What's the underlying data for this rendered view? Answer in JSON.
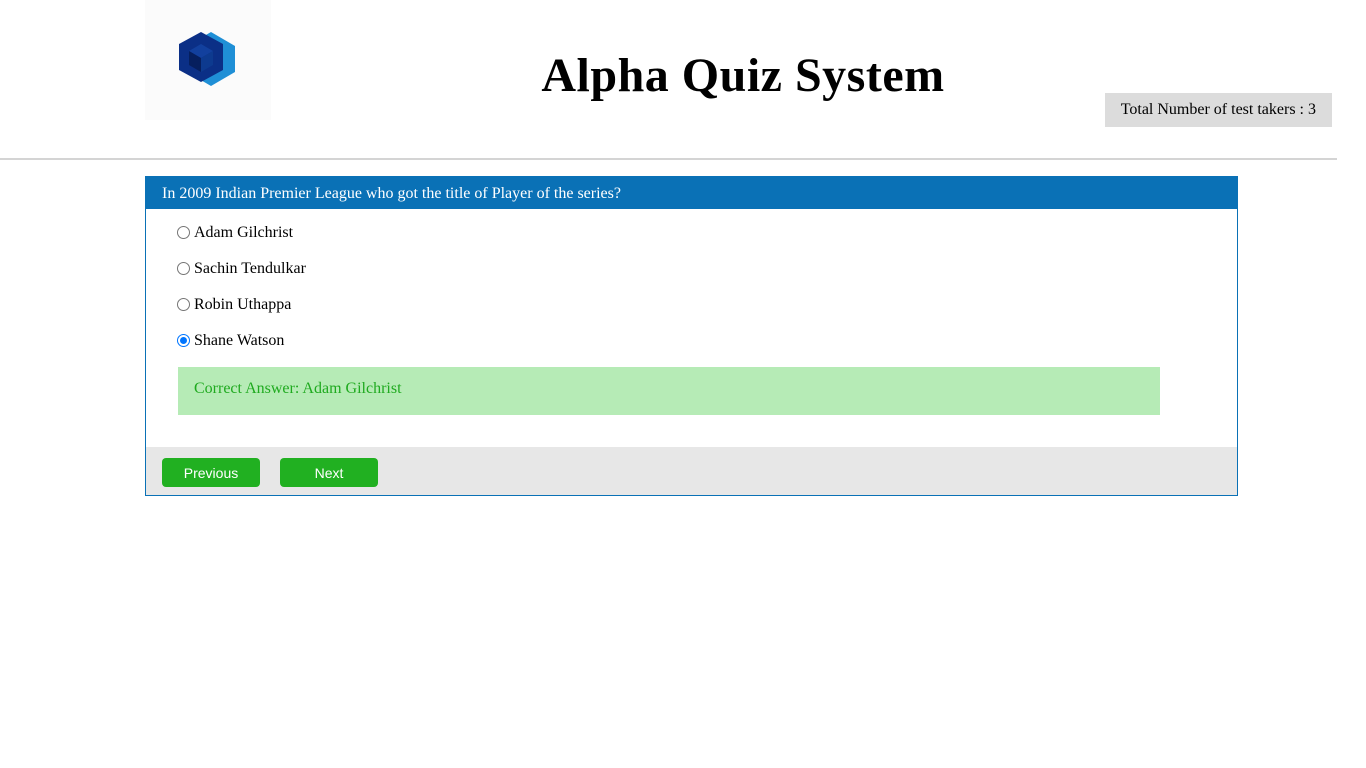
{
  "header": {
    "logo_icon": "hexagon-cube-logo-icon",
    "title": "Alpha Quiz System",
    "takers_label": "Total Number of test takers : 3"
  },
  "quiz": {
    "question": "In 2009 Indian Premier League who got the title of Player of the series?",
    "options": [
      {
        "label": "Adam Gilchrist",
        "selected": false
      },
      {
        "label": "Sachin Tendulkar",
        "selected": false
      },
      {
        "label": "Robin Uthappa",
        "selected": false
      },
      {
        "label": "Shane Watson",
        "selected": true
      }
    ],
    "correct_answer": "Correct Answer: Adam Gilchrist",
    "previous_label": "Previous",
    "next_label": "Next"
  },
  "colors": {
    "accent": "#0a71b6",
    "button": "#21b021",
    "answer_bg": "#b6ebb6",
    "answer_text": "#1faa1f"
  }
}
